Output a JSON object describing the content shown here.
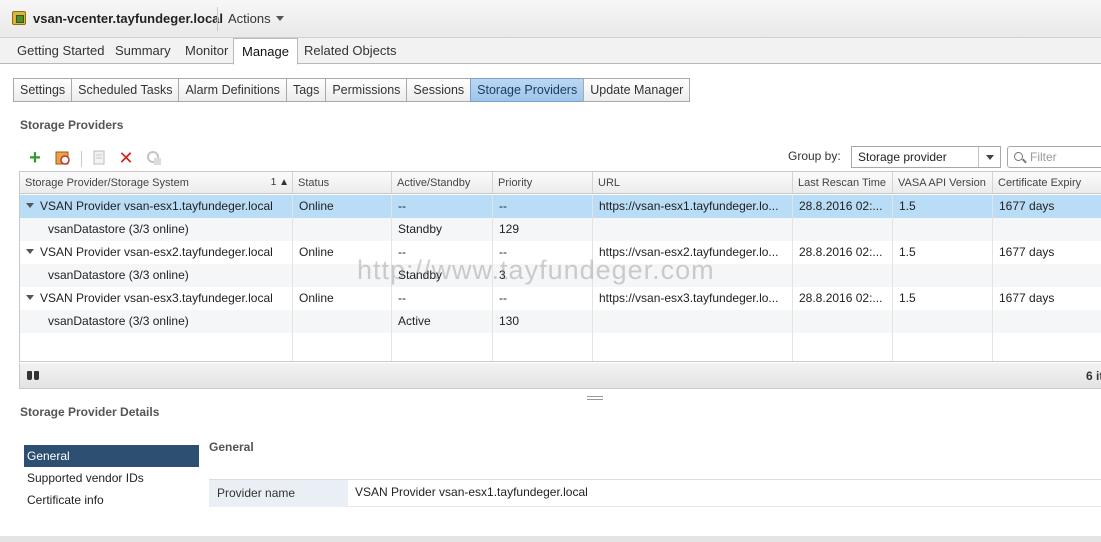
{
  "window": {
    "title": "vsan-vcenter.tayfundeger.local",
    "actions_label": "Actions"
  },
  "main_tabs": [
    "Getting Started",
    "Summary",
    "Monitor",
    "Manage",
    "Related Objects"
  ],
  "sub_tabs": [
    "Settings",
    "Scheduled Tasks",
    "Alarm Definitions",
    "Tags",
    "Permissions",
    "Sessions",
    "Storage Providers",
    "Update Manager"
  ],
  "storage_providers": {
    "heading": "Storage Providers",
    "group_by_label": "Group by:",
    "group_by_value": "Storage provider",
    "filter_placeholder": "Filter",
    "columns": [
      "Storage Provider/Storage System",
      "Status",
      "Active/Standby",
      "Priority",
      "URL",
      "Last Rescan Time",
      "VASA API Version",
      "Certificate Expiry"
    ],
    "sort_indicator": "1 ▲",
    "rows": [
      {
        "name": "VSAN Provider vsan-esx1.tayfundeger.local",
        "status": "Online",
        "active_standby": "--",
        "priority": "--",
        "url": "https://vsan-esx1.tayfundeger.lo...",
        "last_rescan": "28.8.2016 02:...",
        "vasa": "1.5",
        "cert_expiry": "1677 days"
      },
      {
        "name": "vsanDatastore (3/3 online)",
        "status": "",
        "active_standby": "Standby",
        "priority": "129",
        "url": "",
        "last_rescan": "",
        "vasa": "",
        "cert_expiry": ""
      },
      {
        "name": "VSAN Provider vsan-esx2.tayfundeger.local",
        "status": "Online",
        "active_standby": "--",
        "priority": "--",
        "url": "https://vsan-esx2.tayfundeger.lo...",
        "last_rescan": "28.8.2016 02:...",
        "vasa": "1.5",
        "cert_expiry": "1677 days"
      },
      {
        "name": "vsanDatastore (3/3 online)",
        "status": "",
        "active_standby": "Standby",
        "priority": "3",
        "url": "",
        "last_rescan": "",
        "vasa": "",
        "cert_expiry": ""
      },
      {
        "name": "VSAN Provider vsan-esx3.tayfundeger.local",
        "status": "Online",
        "active_standby": "--",
        "priority": "--",
        "url": "https://vsan-esx3.tayfundeger.lo...",
        "last_rescan": "28.8.2016 02:...",
        "vasa": "1.5",
        "cert_expiry": "1677 days"
      },
      {
        "name": "vsanDatastore (3/3 online)",
        "status": "",
        "active_standby": "Active",
        "priority": "130",
        "url": "",
        "last_rescan": "",
        "vasa": "",
        "cert_expiry": ""
      }
    ],
    "item_count": "6 it"
  },
  "details": {
    "heading": "Storage Provider Details",
    "nav": [
      "General",
      "Supported vendor IDs",
      "Certificate info"
    ],
    "general_heading": "General",
    "provider_name_label": "Provider name",
    "provider_name_value": "VSAN Provider vsan-esx1.tayfundeger.local"
  },
  "watermark": "http://www.tayfundeger.com",
  "icons": [
    "vcenter-icon",
    "add-icon",
    "rescan-icon",
    "sync-icon",
    "remove-icon",
    "refresh-certificate-icon",
    "binoculars-icon",
    "search-icon"
  ],
  "colors": {
    "selected_row": "#b9dcf7",
    "active_subtab": "#9ec5ea",
    "nav_active": "#2d4f72",
    "add_green": "#2f9a2f",
    "remove_red": "#d32020"
  }
}
